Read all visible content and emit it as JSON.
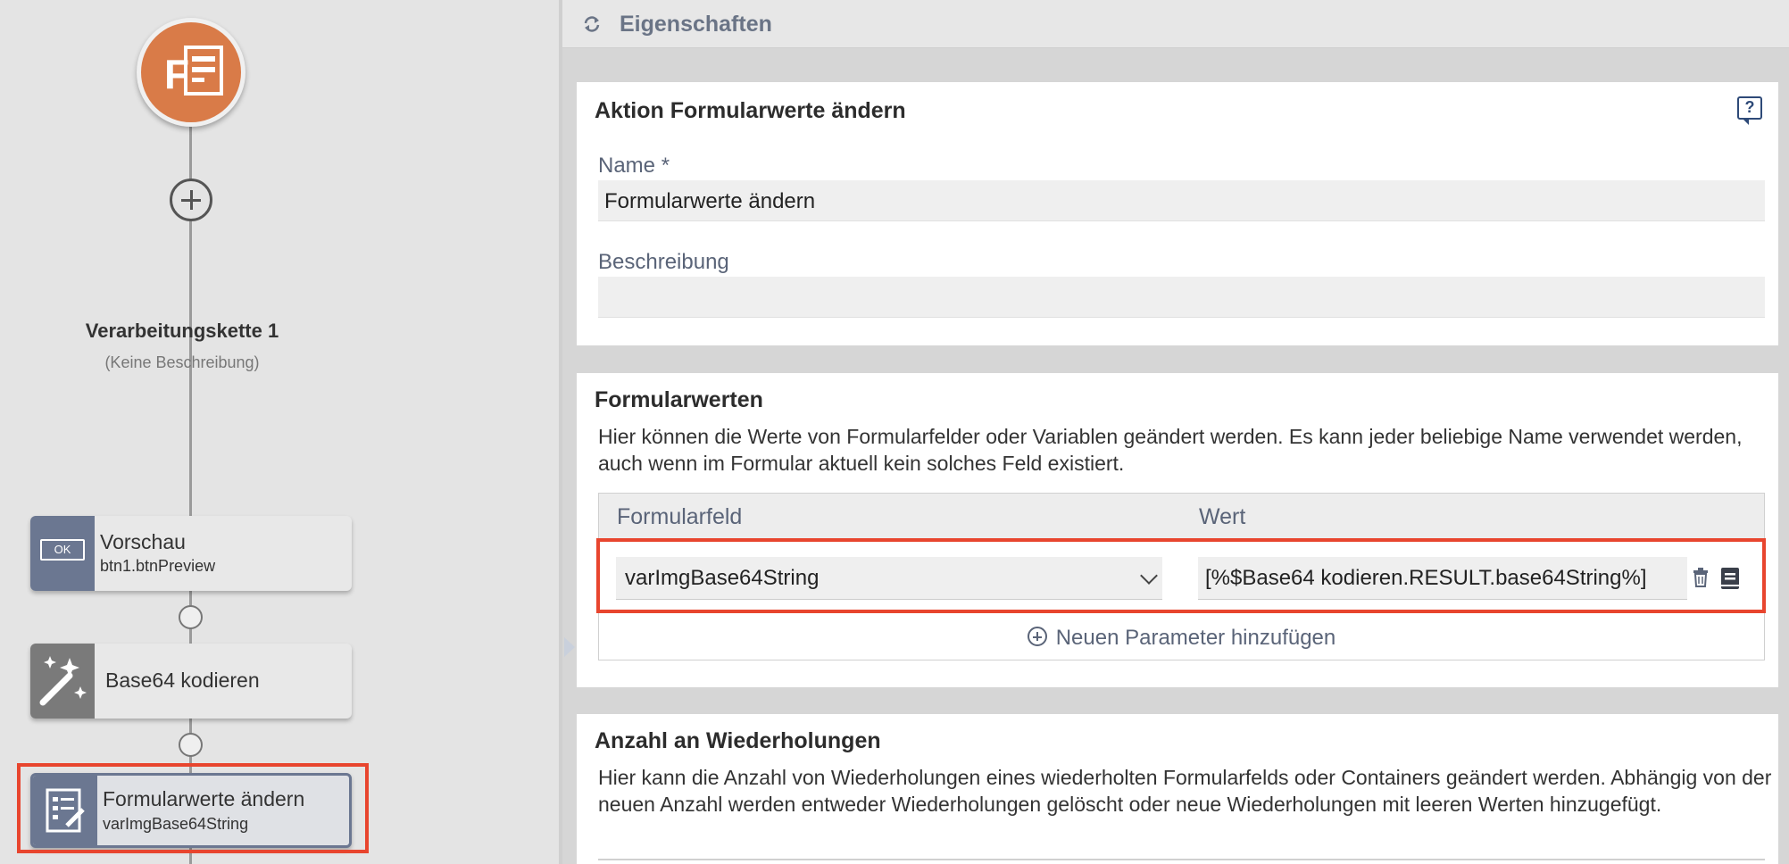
{
  "flow": {
    "chain_title": "Verarbeitungskette 1",
    "chain_description": "(Keine Beschreibung)",
    "nodes": [
      {
        "title": "Vorschau",
        "subtitle": "btn1.btnPreview",
        "badge": "OK",
        "icon": "ok-button-icon",
        "color": "#6b7791"
      },
      {
        "title": "Base64 kodieren",
        "subtitle": "",
        "icon": "magic-wand-icon",
        "color": "#7a7a7a"
      },
      {
        "title": "Formularwerte ändern",
        "subtitle": "varImgBase64String",
        "icon": "form-edit-icon",
        "color": "#6b7791",
        "selected": true
      }
    ],
    "start_icon": "form-logo-icon",
    "accent": "#d97b48"
  },
  "header": {
    "title": "Eigenschaften",
    "icon": "refresh-icon"
  },
  "action_card": {
    "title": "Aktion Formularwerte ändern",
    "name_label": "Name  *",
    "name_value": "Formularwerte ändern",
    "description_label": "Beschreibung",
    "description_value": "",
    "help_icon": "help-icon"
  },
  "values_card": {
    "title": "Formularwerten",
    "description": "Hier können die Werte von Formularfelder oder Variablen geändert werden. Es kann jeder beliebige Name verwendet werden, auch wenn im Formular aktuell kein solches Feld existiert.",
    "columns": [
      "Formularfeld",
      "Wert"
    ],
    "rows": [
      {
        "field": "varImgBase64String",
        "value": "[%$Base64 kodieren.RESULT.base64String%]"
      }
    ],
    "add_label": "Neuen Parameter hinzufügen"
  },
  "repeat_card": {
    "title": "Anzahl an Wiederholungen",
    "description": "Hier kann die Anzahl von Wiederholungen eines wiederholten Formularfelds oder Containers geändert werden. Abhängig von der neuen Anzahl werden entweder Wiederholungen gelöscht oder neue Wiederholungen mit leeren Werten hinzugefügt."
  },
  "highlight_color": "#e8452e"
}
